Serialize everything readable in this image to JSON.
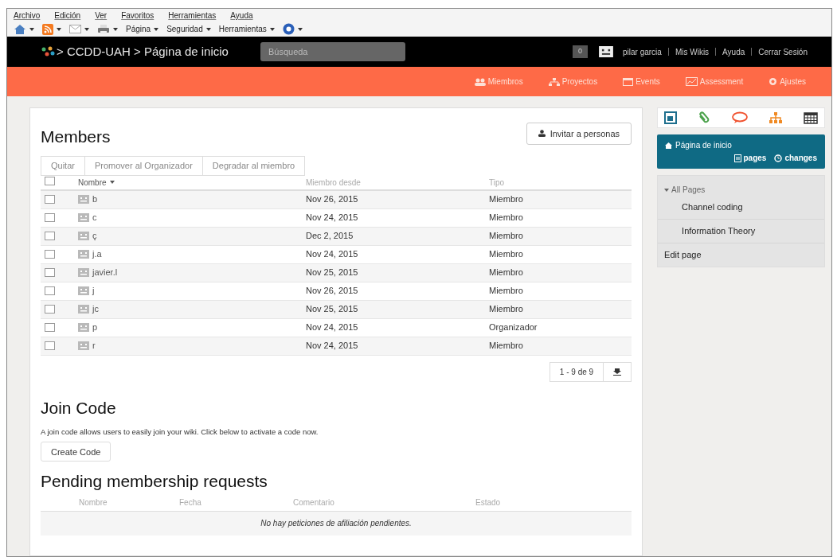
{
  "browser": {
    "menu": [
      "Archivo",
      "Edición",
      "Ver",
      "Favoritos",
      "Herramientas",
      "Ayuda"
    ],
    "toolbar": [
      {
        "kind": "home"
      },
      {
        "kind": "rss"
      },
      {
        "kind": "mail"
      },
      {
        "kind": "print"
      },
      {
        "kind": "menu",
        "label": "Página"
      },
      {
        "kind": "menu",
        "label": "Seguridad"
      },
      {
        "kind": "menu",
        "label": "Herramientas"
      },
      {
        "kind": "help"
      }
    ]
  },
  "header": {
    "breadcrumb": "> CCDD-UAH > Página de inicio",
    "search": {
      "placeholder": "Búsqueda"
    },
    "notifications": "0",
    "user_links": [
      "pilar garcia",
      "Mis Wikis",
      "Ayuda",
      "Cerrar Sesión"
    ]
  },
  "nav": [
    {
      "kind": "members",
      "label": "Miembros"
    },
    {
      "kind": "projects",
      "label": "Proyectos"
    },
    {
      "kind": "events",
      "label": "Events"
    },
    {
      "kind": "assessment",
      "label": "Assessment"
    },
    {
      "kind": "settings",
      "label": "Ajustes"
    }
  ],
  "members": {
    "title": "Members",
    "invite_button": "Invitar a personas",
    "actions": [
      "Quitar",
      "Promover al Organizador",
      "Degradar al miembro"
    ],
    "columns": [
      "Nombre",
      "Miembro desde",
      "Tipo"
    ],
    "select_all": {
      "checked": false
    },
    "rows": [
      {
        "name": "b",
        "since": "Nov 26, 2015",
        "type": "Miembro",
        "checked": false
      },
      {
        "name": "c",
        "since": "Nov 24, 2015",
        "type": "Miembro",
        "checked": false
      },
      {
        "name": "ç",
        "since": "Dec 2, 2015",
        "type": "Miembro",
        "checked": false
      },
      {
        "name": "j.a",
        "since": "Nov 24, 2015",
        "type": "Miembro",
        "checked": false
      },
      {
        "name": "javier.l",
        "since": "Nov 25, 2015",
        "type": "Miembro",
        "checked": false
      },
      {
        "name": "j",
        "since": "Nov 26, 2015",
        "type": "Miembro",
        "checked": false
      },
      {
        "name": "jc",
        "since": "Nov 25, 2015",
        "type": "Miembro",
        "checked": false
      },
      {
        "name": "p",
        "since": "Nov 24, 2015",
        "type": "Organizador",
        "checked": false
      },
      {
        "name": "r",
        "since": "Nov 24, 2015",
        "type": "Miembro",
        "checked": false
      }
    ],
    "pagination": "1 - 9 de 9"
  },
  "join_code": {
    "title": "Join Code",
    "text": "A join code allows users to easily join your wiki. Click below to activate a code now.",
    "button": "Create Code"
  },
  "pending": {
    "title": "Pending membership requests",
    "columns": [
      "Nombre",
      "Fecha",
      "Comentario",
      "Estado"
    ],
    "empty": "No hay peticiones de afiliación pendientes."
  },
  "sidebar": {
    "tools": [
      {
        "kind": "page"
      },
      {
        "kind": "clip"
      },
      {
        "kind": "comment"
      },
      {
        "kind": "tree"
      },
      {
        "kind": "calendar"
      }
    ],
    "current": {
      "title": "Página de inicio",
      "links": [
        "pages",
        "changes"
      ]
    },
    "tree": {
      "label": "All Pages",
      "expanded": true,
      "children": [
        "Channel coding",
        "Information Theory"
      ]
    },
    "edit": "Edit page"
  }
}
